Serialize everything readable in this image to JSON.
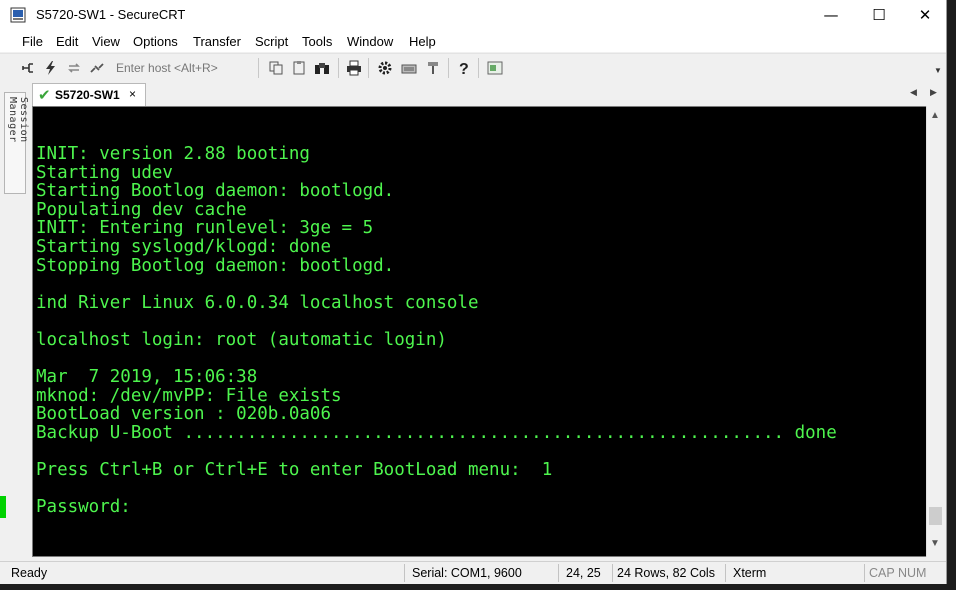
{
  "window": {
    "title": "S5720-SW1 - SecureCRT",
    "min_glyph": "—",
    "max_glyph": "☐",
    "close_glyph": "✕"
  },
  "menu": [
    "File",
    "Edit",
    "View",
    "Options",
    "Transfer",
    "Script",
    "Tools",
    "Window",
    "Help"
  ],
  "toolbar": {
    "host_placeholder": "Enter host <Alt+R>",
    "icons": [
      "connect-icon",
      "quick-connect-icon",
      "reconnect-icon",
      "disconnect-icon",
      "copy-icon",
      "paste-icon",
      "find-icon",
      "print-icon",
      "settings-icon",
      "keymap-icon",
      "sftp-icon",
      "help-icon",
      "screen-icon"
    ]
  },
  "session_manager": {
    "label": "Session Manager"
  },
  "tab": {
    "label": "S5720-SW1",
    "close": "×"
  },
  "terminal": {
    "lines": [
      "INIT: version 2.88 booting",
      "Starting udev",
      "Starting Bootlog daemon: bootlogd.",
      "Populating dev cache",
      "INIT: Entering runlevel: 3ge = 5",
      "Starting syslogd/klogd: done",
      "Stopping Bootlog daemon: bootlogd.",
      "",
      "ind River Linux 6.0.0.34 localhost console",
      "",
      "localhost login: root (automatic login)",
      "",
      "Mar  7 2019, 15:06:38",
      "mknod: /dev/mvPP: File exists",
      "BootLoad version : 020b.0a06",
      "Backup U-Boot ......................................................... done",
      "",
      "Press Ctrl+B or Ctrl+E to enter BootLoad menu:  1",
      "",
      "Password:"
    ],
    "text_color": "#4ef54e",
    "background": "#000000"
  },
  "status": {
    "ready": "Ready",
    "serial": "Serial: COM1, 9600",
    "cursor": "24,  25",
    "size": "24 Rows, 82 Cols",
    "emulation": "Xterm",
    "cap": "CAP",
    "num": "NUM"
  }
}
